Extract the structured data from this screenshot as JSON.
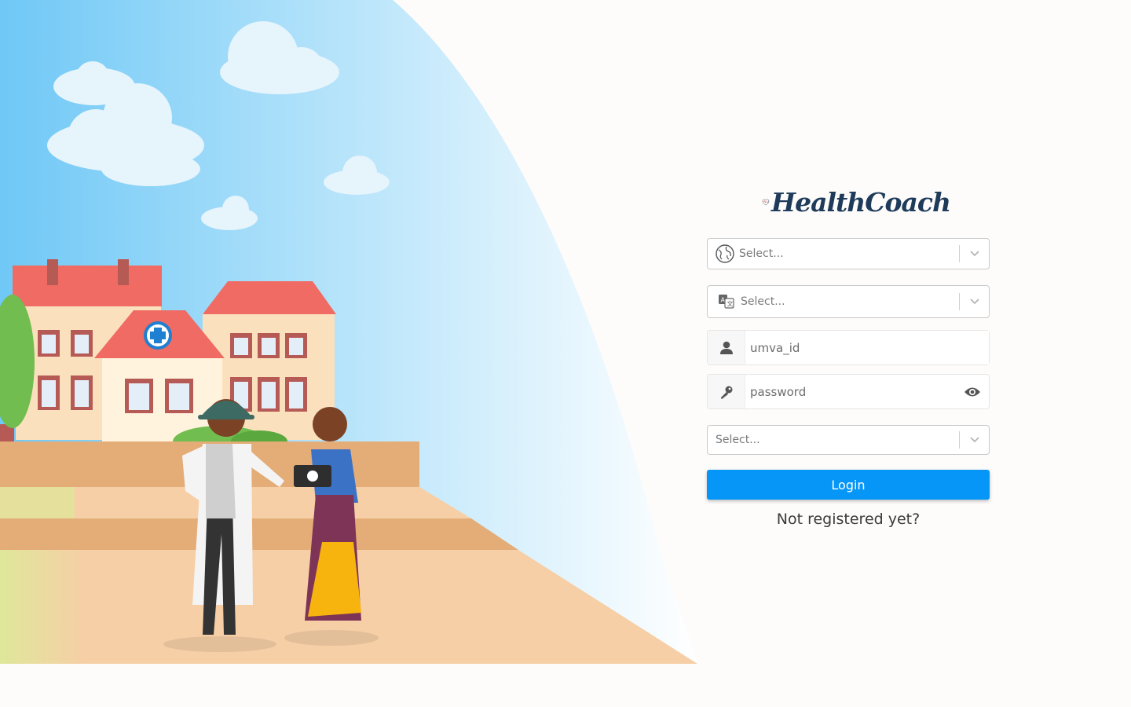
{
  "brand": {
    "name": "HealthCoach"
  },
  "login_form": {
    "country_select": {
      "value": "Select...",
      "icon": "globe-icon"
    },
    "language_select": {
      "value": "Select...",
      "icon": "translate-icon"
    },
    "username": {
      "placeholder": "umva_id",
      "icon": "user-icon"
    },
    "password": {
      "placeholder": "password",
      "icon": "key-icon",
      "toggle_icon": "eye-icon"
    },
    "role_select": {
      "value": "Select..."
    },
    "login_label": "Login",
    "register_label": "Not registered yet?"
  },
  "colors": {
    "primary": "#0696f7",
    "background": "#fdfcfa",
    "brand_text": "#1f3b5a",
    "sky": "#72caf5",
    "roof": "#ee6b62",
    "ground": "#f6cda8"
  }
}
